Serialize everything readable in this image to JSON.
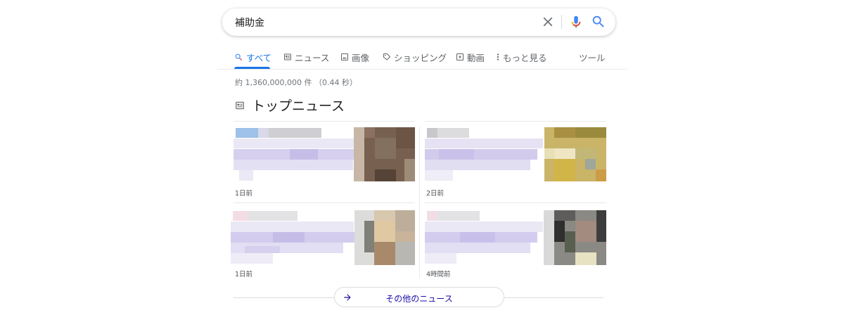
{
  "search": {
    "query": "補助金"
  },
  "tabs": [
    {
      "label": "すべて",
      "icon": "search-icon",
      "active": true
    },
    {
      "label": "ニュース",
      "icon": "news-icon"
    },
    {
      "label": "画像",
      "icon": "image-icon"
    },
    {
      "label": "ショッピング",
      "icon": "tag-icon"
    },
    {
      "label": "動画",
      "icon": "video-icon"
    },
    {
      "label": "もっと見る",
      "icon": "more-vert-icon"
    },
    {
      "label": "ツール"
    }
  ],
  "result_stats": "約 1,360,000,000 件 （0.44 秒）",
  "top_news": {
    "title": "トップニュース",
    "icon": "news-icon",
    "cards": [
      {
        "time": "1日前"
      },
      {
        "time": "2日前"
      },
      {
        "time": "1日前"
      },
      {
        "time": "4時間前"
      }
    ],
    "more_label": "その他のニュース",
    "more_icon": "arrow-right-icon"
  },
  "colors": {
    "accent": "#1a73e8",
    "link": "#1a0dab",
    "muted": "#70757a"
  }
}
